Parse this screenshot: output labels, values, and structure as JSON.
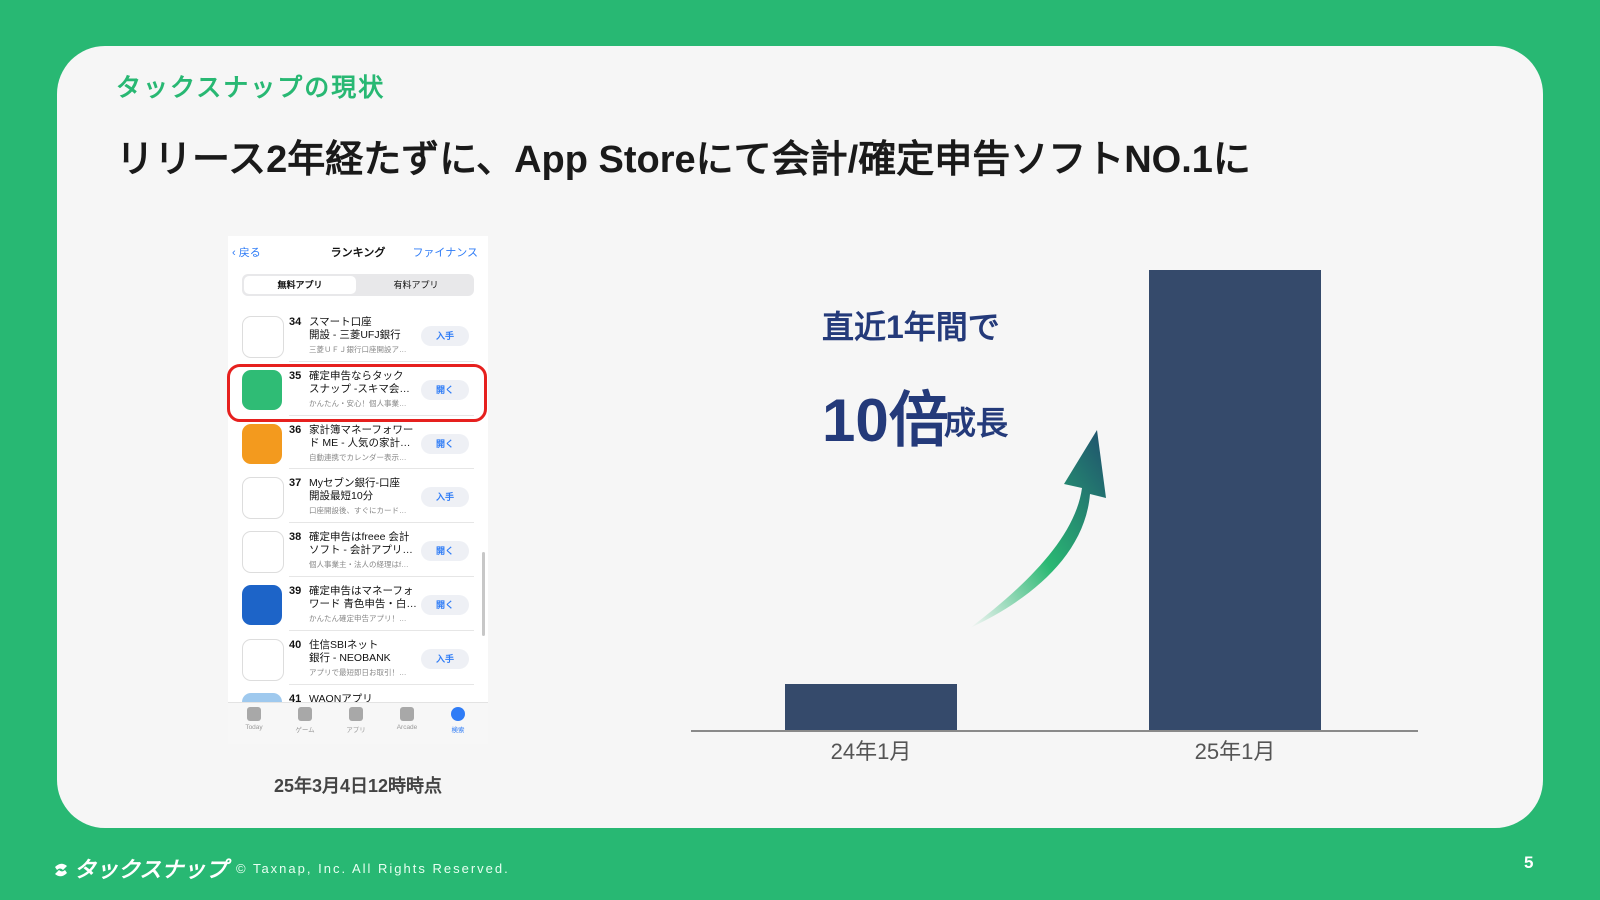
{
  "section_label": "タックスナップの現状",
  "headline": "リリース2年経たずに、App Storeにて会計/確定申告ソフトNO.1に",
  "phone": {
    "back_label": "戻る",
    "title": "ランキング",
    "category": "ファイナンス",
    "segments": [
      "無料アプリ",
      "有料アプリ"
    ],
    "rows": [
      {
        "rank": "34",
        "name": "スマート口座\n開設 - 三菱UFJ銀行",
        "sub": "三菱ＵＦＪ銀行口座開設ア…",
        "button": "入手",
        "icon_color": "#ffffff",
        "icon_name": "mufg-app-icon"
      },
      {
        "rank": "35",
        "name": "確定申告ならタック\nスナップ -スキマ会…",
        "sub": "かんたん・安心！個人事業…",
        "button": "開く",
        "icon_color": "#2fbc75",
        "icon_name": "taxnap-app-icon"
      },
      {
        "rank": "36",
        "name": "家計簿マネーフォワー\nド ME - 人気の家計…",
        "sub": "自動連携でカレンダー表示…",
        "button": "開く",
        "icon_color": "#f39a1e",
        "icon_name": "moneyforward-me-app-icon"
      },
      {
        "rank": "37",
        "name": "Myセブン銀行-口座\n開設最短10分",
        "sub": "口座開設後、すぐにカード…",
        "button": "入手",
        "icon_color": "#ffffff",
        "icon_name": "seven-bank-app-icon"
      },
      {
        "rank": "38",
        "name": "確定申告はfreee 会計\nソフト - 会計アプリ…",
        "sub": "個人事業主・法人の経理はf…",
        "button": "開く",
        "icon_color": "#ffffff",
        "icon_name": "freee-app-icon"
      },
      {
        "rank": "39",
        "name": "確定申告はマネーフォ\nワード 青色申告・白…",
        "sub": "かんたん確定申告アプリ！…",
        "button": "開く",
        "icon_color": "#1d64c8",
        "icon_name": "moneyforward-tax-app-icon"
      },
      {
        "rank": "40",
        "name": "住信SBIネット\n銀行 - NEOBANK",
        "sub": "アプリで最短即日お取引！…",
        "button": "入手",
        "icon_color": "#ffffff",
        "icon_name": "sbi-neobank-app-icon"
      },
      {
        "rank": "41",
        "name": "WAONアプリ",
        "sub": "",
        "button": "",
        "icon_color": "#9fc9ee",
        "icon_name": "waon-app-icon"
      }
    ],
    "tabs": [
      "Today",
      "ゲーム",
      "アプリ",
      "Arcade",
      "検索"
    ]
  },
  "timestamp": "25年3月4日12時時点",
  "growth": {
    "line1": "直近1年間で",
    "big": "10倍",
    "small": "成長"
  },
  "chart_data": {
    "type": "bar",
    "categories": [
      "24年1月",
      "25年1月"
    ],
    "values": [
      1,
      10
    ],
    "bar_color": "#354a6b",
    "title": "",
    "xlabel": "",
    "ylabel": ""
  },
  "footer": {
    "logo": "タックスナップ",
    "copyright": "© Taxnap, Inc. All Rights Reserved.",
    "page_number": "5"
  }
}
